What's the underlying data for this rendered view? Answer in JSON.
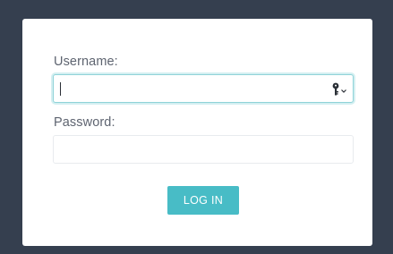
{
  "form": {
    "username_label": "Username:",
    "username_value": "",
    "password_label": "Password:",
    "password_value": "",
    "login_label": "LOG IN"
  },
  "icons": {
    "password_manager": "key-dropdown-icon"
  },
  "colors": {
    "background": "#353f4f",
    "card": "#ffffff",
    "accent": "#48bcc6",
    "focus_border": "#8fd3d8",
    "label": "#5e6470"
  }
}
